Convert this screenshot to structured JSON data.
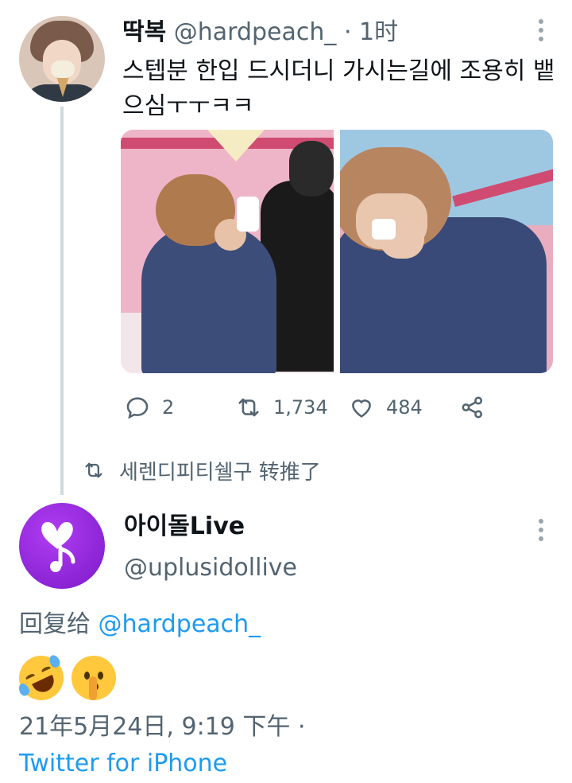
{
  "tweet1": {
    "display_name": "딱복",
    "handle": "@hardpeach_",
    "separator": "·",
    "time": "1时",
    "text": "스텝분 한입 드시더니 가시는길에 조용히 뱉으심ㅜㅜㅋㅋ",
    "actions": {
      "replies": "2",
      "retweets": "1,734",
      "likes": "484"
    },
    "icons": [
      "reply-icon",
      "retweet-icon",
      "like-icon",
      "share-icon",
      "more-icon"
    ]
  },
  "retweet_context": {
    "text": "세렌디피티쉘구 转推了",
    "icon": "retweet-icon"
  },
  "tweet2": {
    "display_name": "아이돌Live",
    "handle": "@uplusidollive",
    "reply_prefix": "回复给",
    "reply_handle": "@hardpeach_",
    "emojis": [
      "rolling-on-floor-laughing-emoji",
      "shushing-face-emoji"
    ],
    "timestamp": "21年5月24日, 9:19 下午 ·",
    "source": "Twitter for iPhone"
  },
  "colors": {
    "link": "#1d9bf0",
    "secondary_text": "#536471",
    "primary_text": "#0f1419",
    "thread_line": "#cfd9de",
    "avatar_purple": "#9b2be0"
  }
}
